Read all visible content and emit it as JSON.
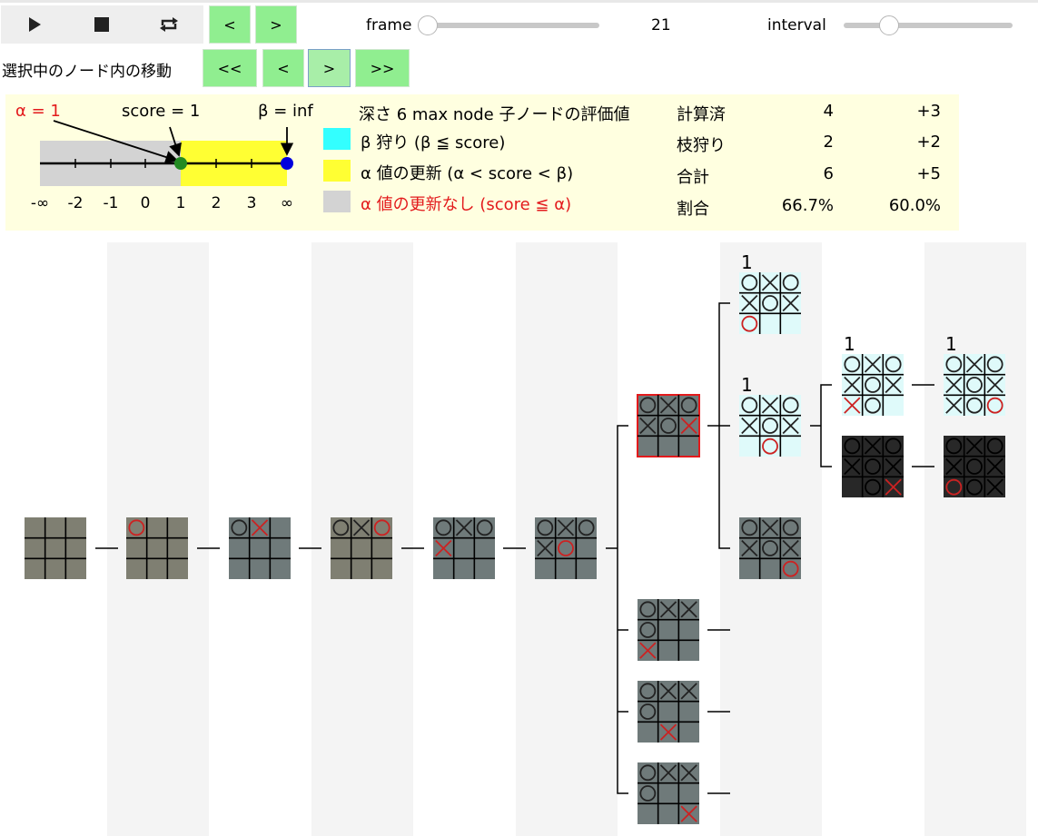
{
  "controls": {
    "play_icon": "play-icon",
    "stop_icon": "stop-icon",
    "repeat_icon": "repeat-icon",
    "prev_label": "<",
    "next_label": ">",
    "frame_label": "frame",
    "frame_value": "21",
    "frame_fraction": 0.0,
    "interval_label": "interval",
    "interval_fraction": 0.24
  },
  "node_nav": {
    "label": "選択中のノード内の移動",
    "buttons": [
      "<<",
      "<",
      ">",
      ">>"
    ],
    "selected_index": 2
  },
  "info": {
    "alpha_label": "α = 1",
    "score_label": "score = 1",
    "beta_label": "β = inf",
    "number_line": {
      "ticks": [
        "-∞",
        "-2",
        "-1",
        "0",
        "1",
        "2",
        "3",
        "∞"
      ],
      "alpha": 1,
      "score": 1,
      "beta": "inf"
    },
    "header": "深さ 6 max node 子ノードの評価値",
    "legend": [
      {
        "text": "β 狩り (β ≦ score)",
        "color": "#33ffff"
      },
      {
        "text": "α 値の更新 (α < score < β)",
        "color": "#ffff33"
      },
      {
        "text": "α 値の更新なし (score ≦ α)",
        "color": "#d3d3d3"
      }
    ],
    "stats": [
      {
        "label": "計算済",
        "a": "4",
        "b": "+3"
      },
      {
        "label": "枝狩り",
        "a": "2",
        "b": "+2"
      },
      {
        "label": "合計",
        "a": "6",
        "b": "+5"
      },
      {
        "label": "割合",
        "a": "66.7%",
        "b": "60.0%"
      }
    ]
  },
  "tree": {
    "colors": {
      "path_node": "#7f7f72",
      "visited_node": "#6f7a7a",
      "selected_border": "#e31a1c",
      "beta_cut_fill": "#dffafa",
      "pruned_node": "#282828",
      "mark_o": "#222222",
      "mark_x": "#222222",
      "last_move": "#cc2222"
    },
    "score_labels": [
      "1",
      "1",
      "1",
      "1"
    ],
    "nodes": [
      {
        "id": "d0",
        "board": "         ",
        "style": "path"
      },
      {
        "id": "d1",
        "board": "o        ",
        "style": "path",
        "last": 0
      },
      {
        "id": "d2",
        "board": "ox       ",
        "style": "visited",
        "last": 1
      },
      {
        "id": "d3",
        "board": "oxo      ",
        "style": "path",
        "last": 2
      },
      {
        "id": "d4",
        "board": "oxox     ",
        "style": "visited",
        "last": 3
      },
      {
        "id": "d5",
        "board": "oxoxo    ",
        "style": "visited",
        "last": 4
      },
      {
        "id": "d6a",
        "board": "oxoxox   ",
        "style": "selected",
        "last": 5
      },
      {
        "id": "d6b",
        "board": "oxxo  x  ",
        "style": "visited",
        "last": 6
      },
      {
        "id": "d6c",
        "board": "oxxo   x ",
        "style": "visited",
        "last": 7
      },
      {
        "id": "d6d",
        "board": "oxxo    x",
        "style": "visited",
        "last": 8
      },
      {
        "id": "d7a",
        "board": "oxoxoxo  ",
        "style": "cut",
        "score": "1",
        "last": 6
      },
      {
        "id": "d7b",
        "board": "oxoxox o ",
        "style": "cut",
        "score": "1",
        "last": 7
      },
      {
        "id": "d7c",
        "board": "oxoxox  o",
        "style": "visited",
        "last": 8
      },
      {
        "id": "d8a",
        "board": "oxoxoxxo ",
        "style": "cut",
        "score": "1",
        "last": 6
      },
      {
        "id": "d8b",
        "board": "oxoxox ox",
        "style": "pruned",
        "last": 8
      },
      {
        "id": "d9a",
        "board": "oxoxoxxoo",
        "style": "cut",
        "score": "1",
        "last": 8
      },
      {
        "id": "d9b",
        "board": "oxoxoxoox",
        "style": "pruned",
        "last": 6
      }
    ]
  }
}
